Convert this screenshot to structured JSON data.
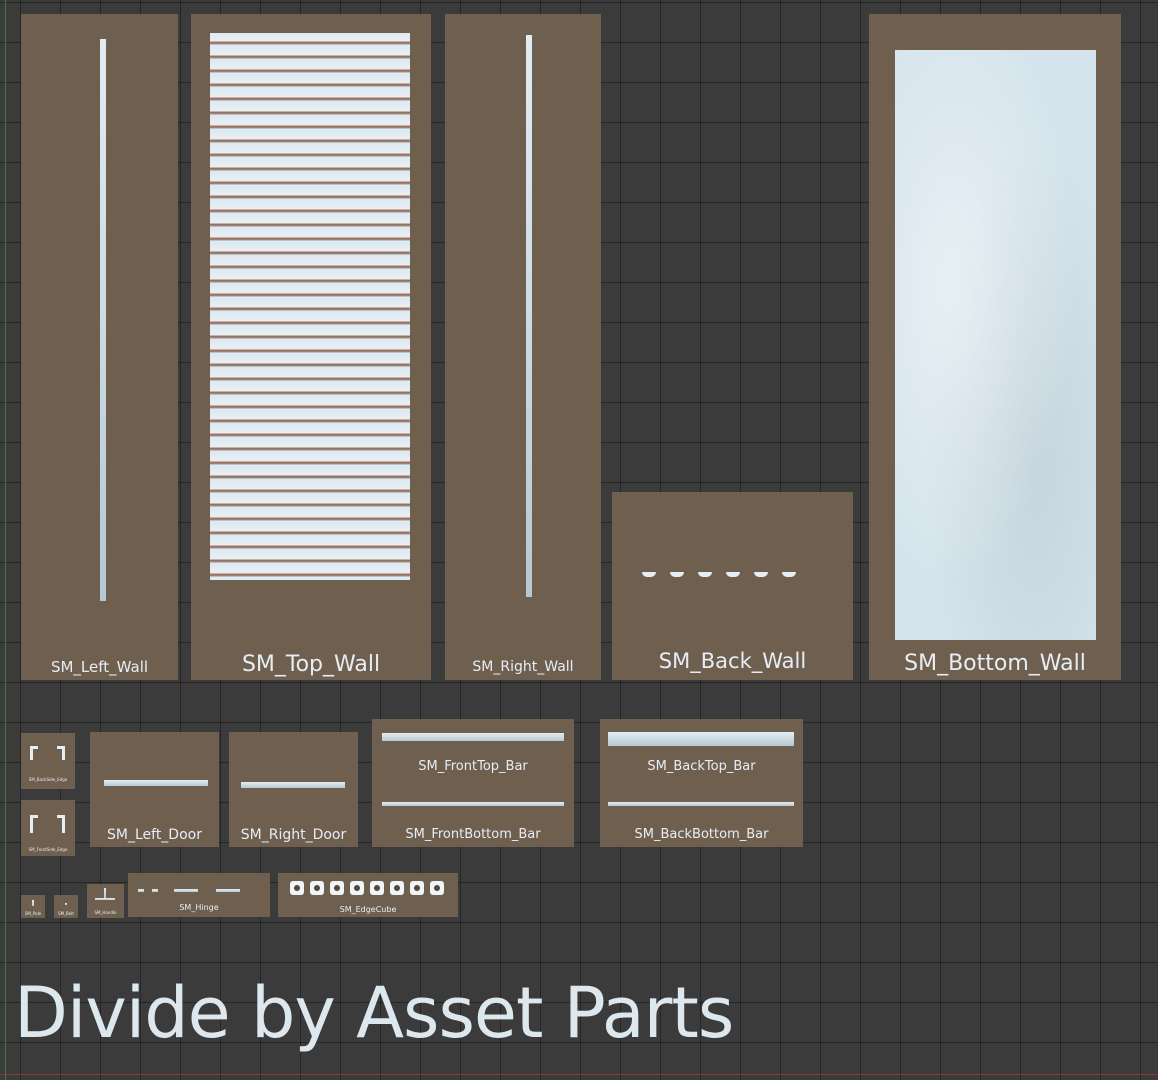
{
  "title": "Divide by Asset Parts",
  "tiles": {
    "left_wall": "SM_Left_Wall",
    "top_wall": "SM_Top_Wall",
    "right_wall": "SM_Right_Wall",
    "back_wall": "SM_Back_Wall",
    "bottom_wall": "SM_Bottom_Wall",
    "backside_edge": "SM_BackSide_Edge",
    "frontside_edge": "SM_FrontSide_Edge",
    "left_door": "SM_Left_Door",
    "right_door": "SM_Right_Door",
    "fronttop_bar": "SM_FrontTop_Bar",
    "frontbottom_bar": "SM_FrontBottom_Bar",
    "backtop_bar": "SM_BackTop_Bar",
    "backbottom_bar": "SM_BackBottom_Bar",
    "pole": "SM_Pole",
    "bolt": "SM_Bolt",
    "handle": "SM_Handle",
    "hinge": "SM_Hinge",
    "edgecube": "SM_EdgeCube"
  },
  "colors": {
    "background": "#3b3b3b",
    "tile": "#6f5f4f",
    "metal": "#d5e4ec",
    "rust": "#a86f56",
    "label": "#e6eef5"
  }
}
